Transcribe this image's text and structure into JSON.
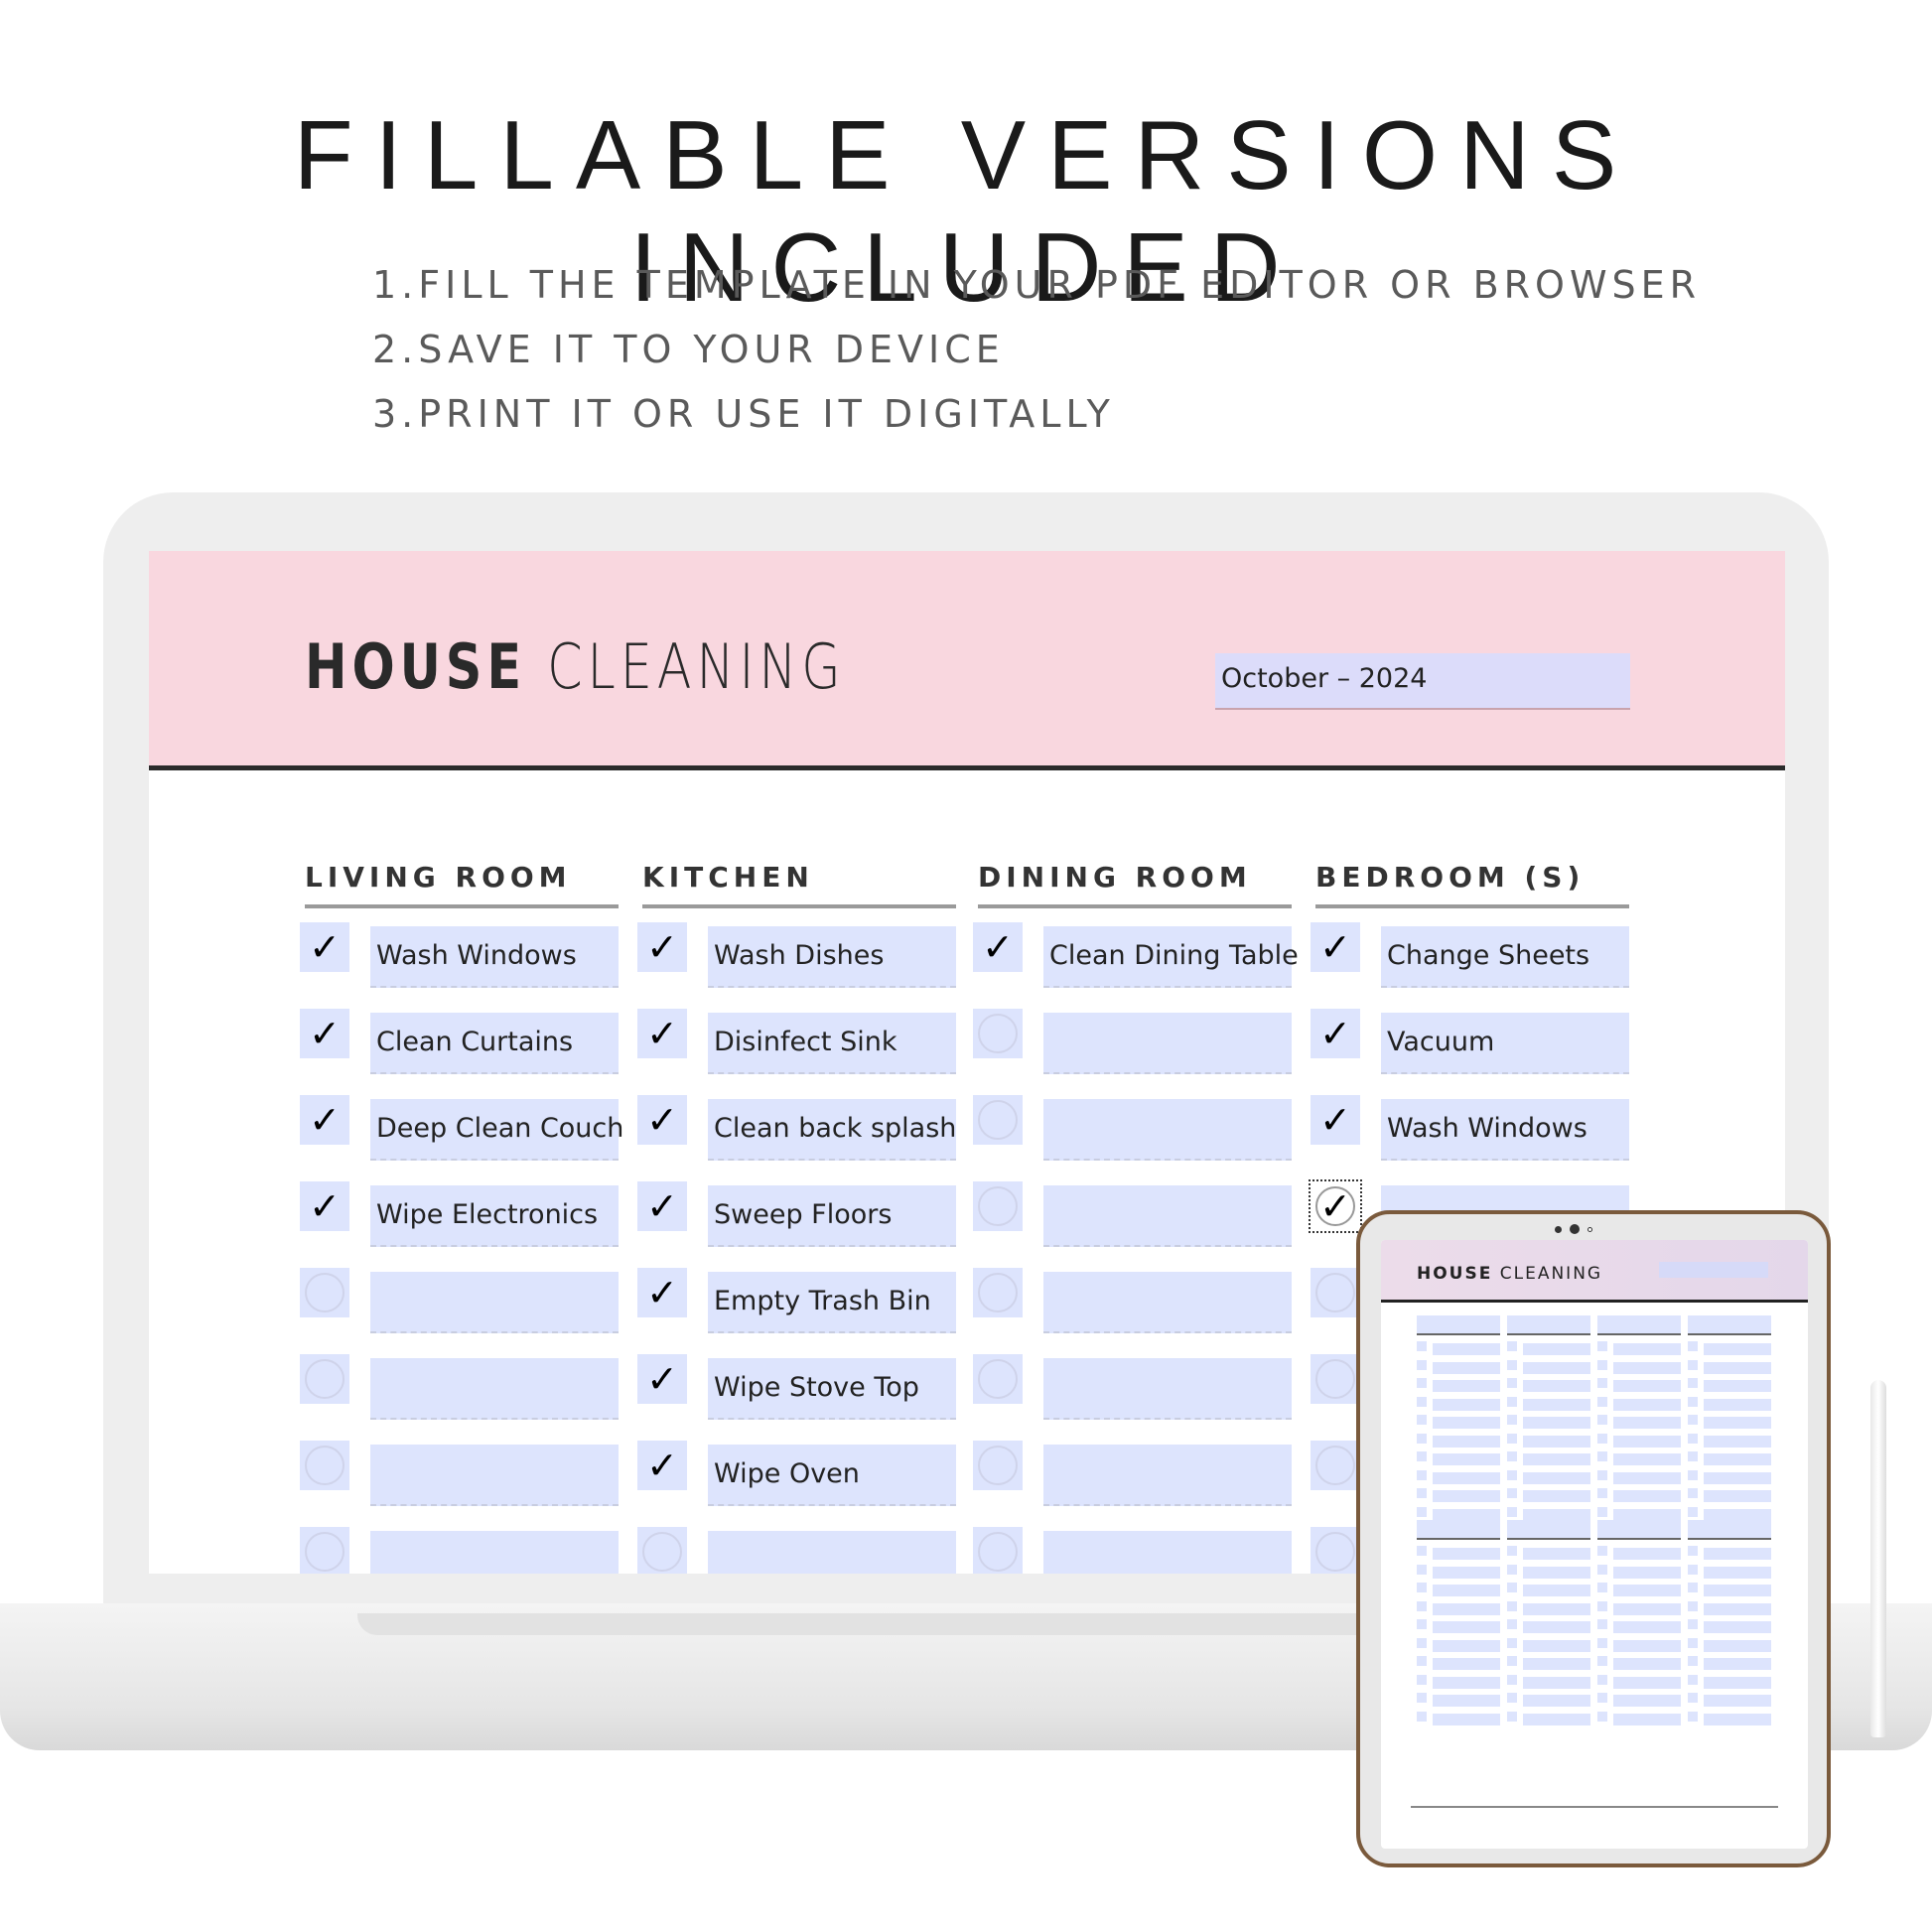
{
  "headline": "FILLABLE VERSIONS INCLUDED",
  "steps": [
    "1.FILL THE TEMPLATE IN YOUR PDF EDITOR OR BROWSER",
    "2.SAVE IT TO YOUR DEVICE",
    "3.PRINT IT OR USE IT DIGITALLY"
  ],
  "planner": {
    "title_bold": "HOUSE",
    "title_light": "CLEANING",
    "date": "October – 2024",
    "colors": {
      "header": "#f9d7df",
      "field": "#dde4fd",
      "tablet_frame": "#7a5a3c"
    },
    "columns": [
      {
        "heading": "LIVING ROOM",
        "rows": [
          {
            "text": "Wash Windows",
            "checked": true
          },
          {
            "text": "Clean Curtains",
            "checked": true
          },
          {
            "text": "Deep Clean Couch",
            "checked": true
          },
          {
            "text": "Wipe Electronics",
            "checked": true
          },
          {
            "text": "",
            "checked": false
          },
          {
            "text": "",
            "checked": false
          },
          {
            "text": "",
            "checked": false
          },
          {
            "text": "",
            "checked": false
          }
        ]
      },
      {
        "heading": "KITCHEN",
        "rows": [
          {
            "text": "Wash Dishes",
            "checked": true
          },
          {
            "text": "Disinfect Sink",
            "checked": true
          },
          {
            "text": "Clean back splash",
            "checked": true
          },
          {
            "text": "Sweep Floors",
            "checked": true
          },
          {
            "text": "Empty Trash Bin",
            "checked": true
          },
          {
            "text": "Wipe Stove Top",
            "checked": true
          },
          {
            "text": "Wipe Oven",
            "checked": true
          },
          {
            "text": "",
            "checked": false
          }
        ]
      },
      {
        "heading": "DINING ROOM",
        "rows": [
          {
            "text": "Clean Dining Table",
            "checked": true
          },
          {
            "text": "",
            "checked": false
          },
          {
            "text": "",
            "checked": false
          },
          {
            "text": "",
            "checked": false
          },
          {
            "text": "",
            "checked": false
          },
          {
            "text": "",
            "checked": false
          },
          {
            "text": "",
            "checked": false
          },
          {
            "text": "",
            "checked": false
          }
        ]
      },
      {
        "heading": "BEDROOM (S)",
        "rows": [
          {
            "text": "Change Sheets",
            "checked": true
          },
          {
            "text": "Vacuum",
            "checked": true
          },
          {
            "text": "Wash Windows",
            "checked": true
          },
          {
            "text": "",
            "checked": true,
            "focused": true
          },
          {
            "text": "",
            "checked": false
          },
          {
            "text": "",
            "checked": false
          },
          {
            "text": "",
            "checked": false
          },
          {
            "text": "",
            "checked": false
          }
        ]
      }
    ]
  },
  "tablet": {
    "title_bold": "HOUSE",
    "title_light": "CLEANING"
  }
}
